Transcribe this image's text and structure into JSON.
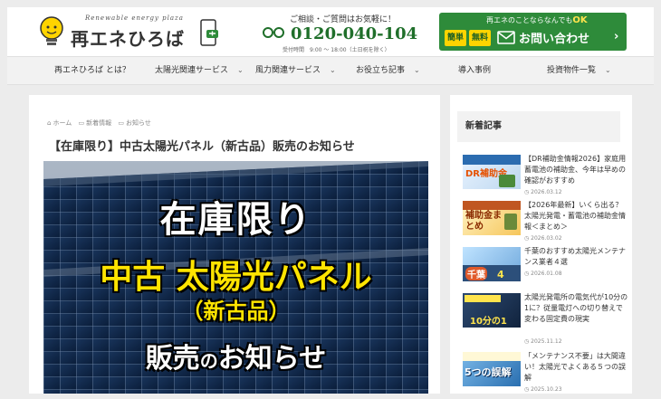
{
  "site": {
    "logo_sub": "Renewable energy plaza",
    "logo_title": "再エネひろば",
    "contact_top": "ご相談・ご質問はお気軽に！",
    "phone": "0120-040-104",
    "hours": "受付時間　9:00 ～ 18:00（土日祝を除く）",
    "cta_top": "再エネのことならなんでも",
    "cta_ok": "OK",
    "cta_badge1": "簡単",
    "cta_badge2": "無料",
    "cta_label": "お問い合わせ",
    "cta_chevron": "›",
    "brand_green": "#2e8b3a",
    "accent_yellow": "#ffd400"
  },
  "nav": {
    "items": [
      {
        "label": "再エネひろば とは？",
        "dropdown": false
      },
      {
        "label": "太陽光関連サービス",
        "dropdown": true
      },
      {
        "label": "風力関連サービス",
        "dropdown": true
      },
      {
        "label": "お役立ち記事",
        "dropdown": true
      },
      {
        "label": "導入事例",
        "dropdown": false
      },
      {
        "label": "投資物件一覧",
        "dropdown": true
      }
    ],
    "chevron": "⌄"
  },
  "breadcrumb": [
    "ホーム",
    "新着情報",
    "お知らせ"
  ],
  "post": {
    "title": "【在庫限り】中古太陽光パネル（新古品）販売のお知らせ",
    "hero_line1": "在庫限り",
    "hero_line2": "中古 太陽光パネル",
    "hero_line3": "（新古品）",
    "hero_line4a": "販売",
    "hero_line4b": "の",
    "hero_line4c": "お知らせ"
  },
  "sidebar": {
    "heading": "新着記事",
    "items": [
      {
        "title": "【DR補助金情報2026】家庭用蓄電池の補助金、今年は早めの確認がおすすめ",
        "date": "2026.03.12",
        "thumb": "DR補助金"
      },
      {
        "title": "【2026年最新】いくら出る？ 太陽光発電・蓄電池の補助金情報＜まとめ＞",
        "date": "2026.03.02",
        "thumb": "補助金まとめ"
      },
      {
        "title": "千葉のおすすめ太陽光メンテナンス業者４選",
        "date": "2026.01.08",
        "thumb": "千葉"
      },
      {
        "title": "太陽光発電所の電気代が10分の1に？従量電灯への切り替えで変わる固定費の現実",
        "date": "2025.11.12",
        "thumb": "10分の1"
      },
      {
        "title": "「メンテナンス不要」は大間違い！太陽光でよくある５つの誤解",
        "date": "2025.10.23",
        "thumb": "5つの誤解"
      }
    ]
  }
}
